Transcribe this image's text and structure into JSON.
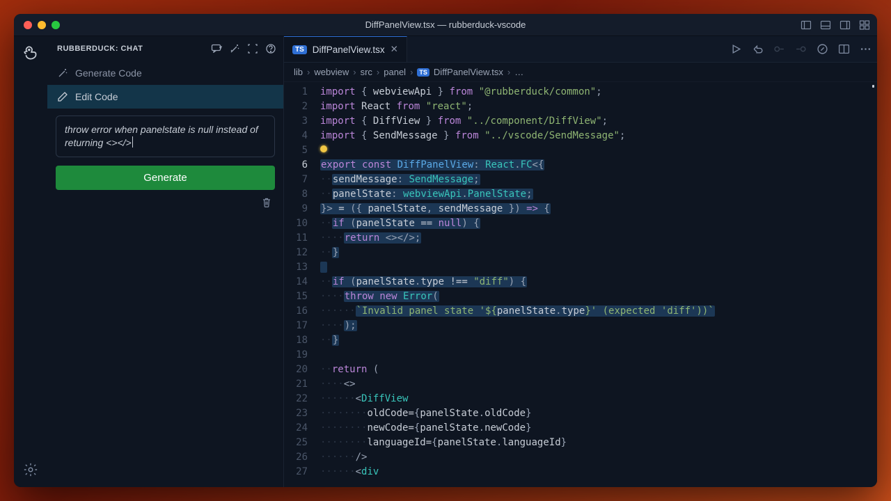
{
  "window": {
    "title": "DiffPanelView.tsx — rubberduck-vscode"
  },
  "sidebar": {
    "title": "RUBBERDUCK: CHAT",
    "generate_code_label": "Generate Code",
    "edit_code_label": "Edit Code",
    "prompt_text": "throw error when panelstate is null instead of returning <></>",
    "generate_button": "Generate"
  },
  "tab": {
    "filename": "DiffPanelView.tsx",
    "lang_badge": "TS"
  },
  "breadcrumb": {
    "segments": [
      "lib",
      "webview",
      "src",
      "panel"
    ],
    "file_badge": "TS",
    "file": "DiffPanelView.tsx",
    "trailing": "…"
  },
  "code": {
    "lines": [
      {
        "n": 1,
        "html": "<span class='kw'>import</span> <span class='punct'>{</span> <span class='prop'>webviewApi</span> <span class='punct'>}</span> <span class='kw'>from</span> <span class='str'>\"@rubberduck/common\"</span><span class='punct'>;</span>"
      },
      {
        "n": 2,
        "html": "<span class='kw'>import</span> <span class='prop'>React</span> <span class='kw'>from</span> <span class='str'>\"react\"</span><span class='punct'>;</span>"
      },
      {
        "n": 3,
        "html": "<span class='kw'>import</span> <span class='punct'>{</span> <span class='prop'>DiffView</span> <span class='punct'>}</span> <span class='kw'>from</span> <span class='str'>\"../component/DiffView\"</span><span class='punct'>;</span>"
      },
      {
        "n": 4,
        "html": "<span class='kw'>import</span> <span class='punct'>{</span> <span class='prop'>SendMessage</span> <span class='punct'>}</span> <span class='kw'>from</span> <span class='str'>\"../vscode/SendMessage\"</span><span class='punct'>;</span>"
      },
      {
        "n": 5,
        "html": "<span class='bulb'></span>"
      },
      {
        "n": 6,
        "cur": true,
        "html": "<span class='sel'><span class='kw'>export</span> <span class='kw'>const</span> <span class='fn-name'>DiffPanelView</span><span class='punct'>:</span> <span class='type'>React</span><span class='punct'>.</span><span class='type'>FC</span><span class='punct'>&lt;{</span></span>"
      },
      {
        "n": 7,
        "html": "<span class='indent'>··</span><span class='sel'><span class='prop'>sendMessage</span><span class='punct'>:</span> <span class='type'>SendMessage</span><span class='punct'>;</span></span>"
      },
      {
        "n": 8,
        "html": "<span class='indent'>··</span><span class='sel'><span class='prop'>panelState</span><span class='punct'>:</span> <span class='type'>webviewApi</span><span class='punct'>.</span><span class='type'>PanelState</span><span class='punct'>;</span></span>"
      },
      {
        "n": 9,
        "html": "<span class='sel'><span class='punct'>}&gt;</span> <span class='op'>=</span> <span class='punct'>({</span> <span class='prop'>panelState</span><span class='punct'>,</span> <span class='prop'>sendMessage</span> <span class='punct'>})</span> <span class='kw'>=&gt;</span> <span class='punct'>{</span></span>"
      },
      {
        "n": 10,
        "html": "<span class='indent'>··</span><span class='sel'><span class='kw'>if</span> <span class='punct'>(</span><span class='prop'>panelState</span> <span class='op'>==</span> <span class='kw'>null</span><span class='punct'>)</span> <span class='punct'>{</span></span>"
      },
      {
        "n": 11,
        "html": "<span class='indent'>····</span><span class='sel'><span class='kw'>return</span> <span class='punct'>&lt;&gt;&lt;/&gt;;</span></span>"
      },
      {
        "n": 12,
        "html": "<span class='indent'>··</span><span class='sel'><span class='punct'>}</span></span>"
      },
      {
        "n": 13,
        "html": "<span class='sel'> </span>"
      },
      {
        "n": 14,
        "html": "<span class='indent'>··</span><span class='sel'><span class='kw'>if</span> <span class='punct'>(</span><span class='prop'>panelState</span><span class='punct'>.</span><span class='prop'>type</span> <span class='op'>!==</span> <span class='str'>\"diff\"</span><span class='punct'>)</span> <span class='punct'>{</span></span>"
      },
      {
        "n": 15,
        "html": "<span class='indent'>····</span><span class='sel'><span class='kw'>throw</span> <span class='kw'>new</span> <span class='type'>Error</span><span class='punct'>(</span></span>"
      },
      {
        "n": 16,
        "html": "<span class='indent'>······</span><span class='sel'><span class='str'>`Invalid panel state '${</span><span class='prop'>panelState</span><span class='punct'>.</span><span class='prop'>type</span><span class='str'>}' (expected 'diff'))`</span></span>"
      },
      {
        "n": 17,
        "html": "<span class='indent'>····</span><span class='sel'><span class='punct'>);</span></span>"
      },
      {
        "n": 18,
        "html": "<span class='indent'>··</span><span class='sel'><span class='punct'>}</span></span>"
      },
      {
        "n": 19,
        "html": ""
      },
      {
        "n": 20,
        "html": "<span class='indent'>··</span><span class='kw'>return</span> <span class='punct'>(</span>"
      },
      {
        "n": 21,
        "html": "<span class='indent'>····</span><span class='punct'>&lt;&gt;</span>"
      },
      {
        "n": 22,
        "html": "<span class='indent'>······</span><span class='punct'>&lt;</span><span class='type'>DiffView</span>"
      },
      {
        "n": 23,
        "html": "<span class='indent'>········</span><span class='prop'>oldCode</span><span class='op'>=</span><span class='punct'>{</span><span class='prop'>panelState</span><span class='punct'>.</span><span class='prop'>oldCode</span><span class='punct'>}</span>"
      },
      {
        "n": 24,
        "html": "<span class='indent'>········</span><span class='prop'>newCode</span><span class='op'>=</span><span class='punct'>{</span><span class='prop'>panelState</span><span class='punct'>.</span><span class='prop'>newCode</span><span class='punct'>}</span>"
      },
      {
        "n": 25,
        "html": "<span class='indent'>········</span><span class='prop'>languageId</span><span class='op'>=</span><span class='punct'>{</span><span class='prop'>panelState</span><span class='punct'>.</span><span class='prop'>languageId</span><span class='punct'>}</span>"
      },
      {
        "n": 26,
        "html": "<span class='indent'>······</span><span class='punct'>/&gt;</span>"
      },
      {
        "n": 27,
        "html": "<span class='indent'>······</span><span class='punct'>&lt;</span><span class='type'>div</span>"
      }
    ]
  }
}
